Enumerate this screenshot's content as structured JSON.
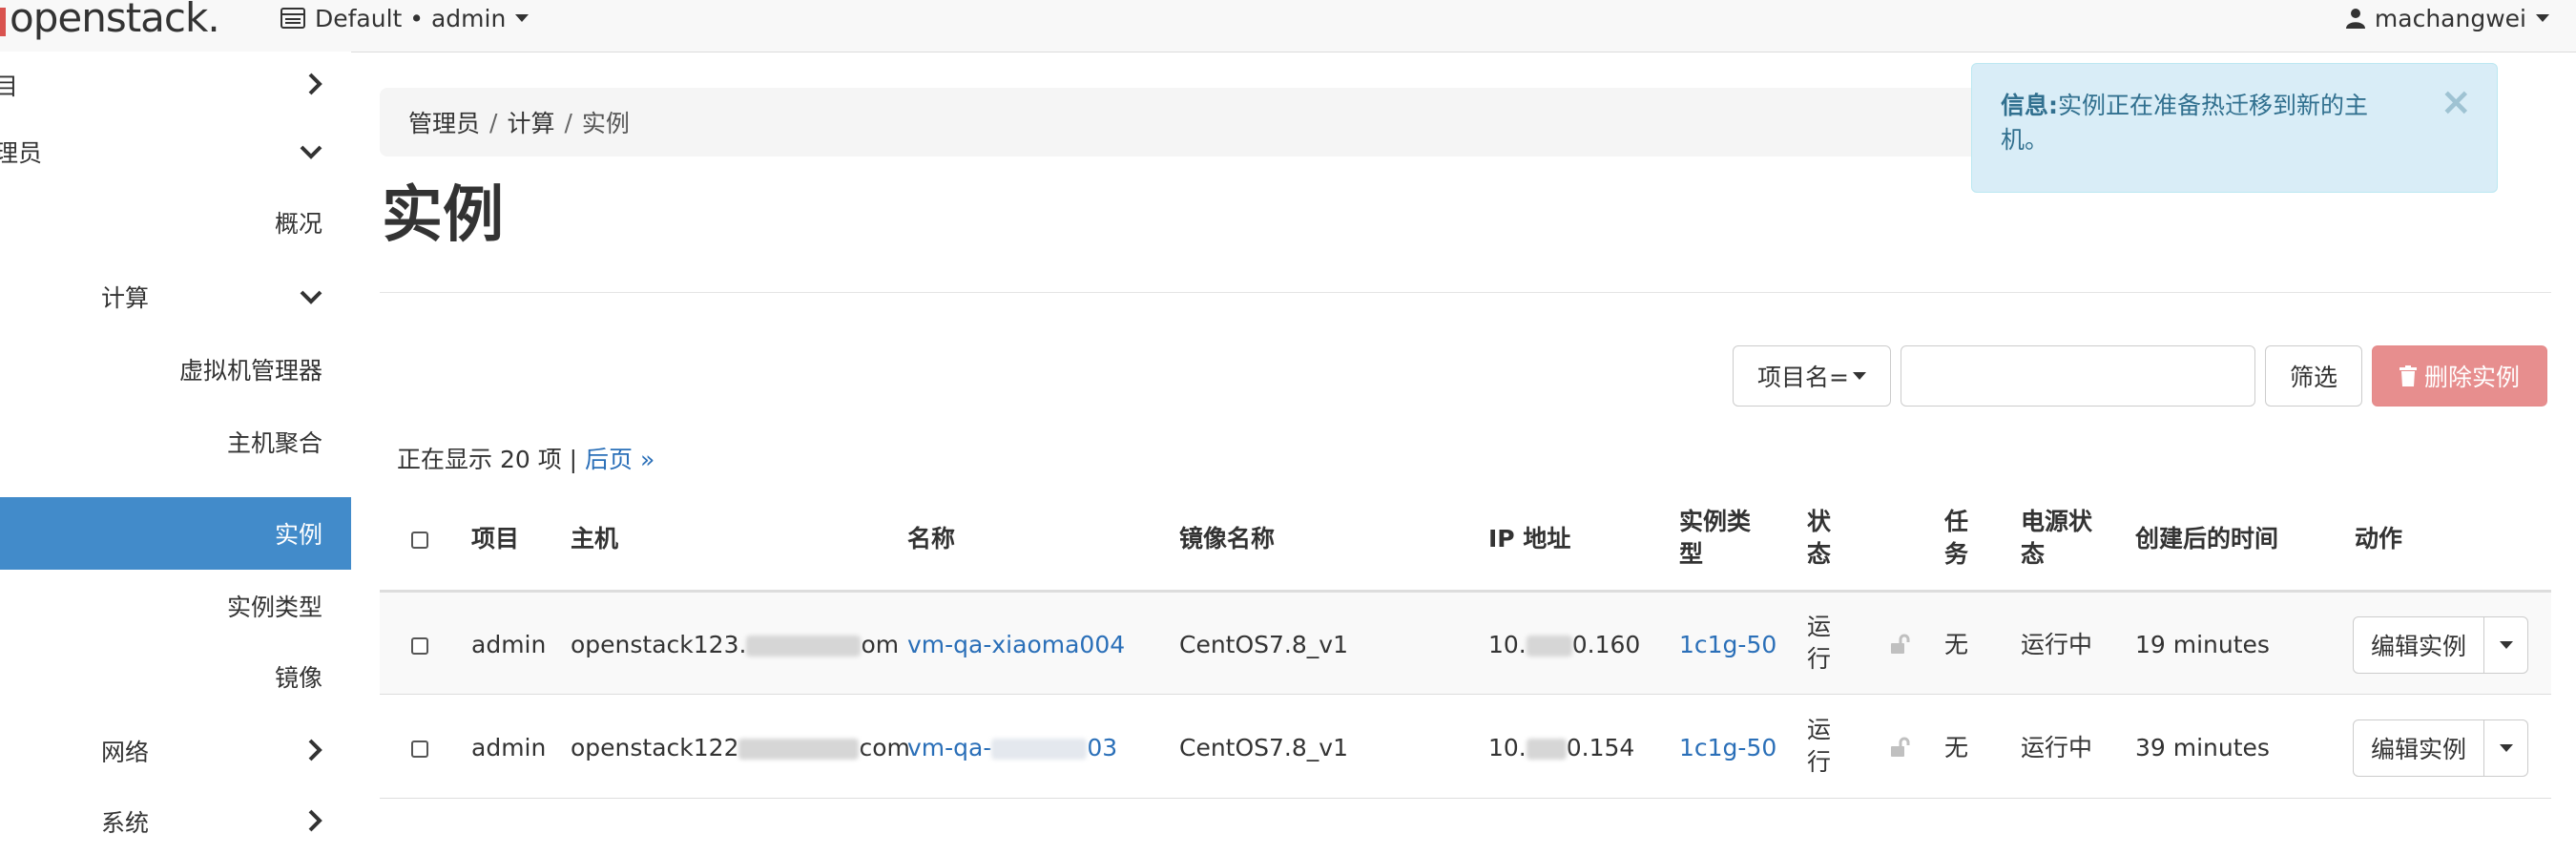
{
  "navbar": {
    "brand": "openstack.",
    "context": "Default • admin",
    "user": "machangwei"
  },
  "sidebar": {
    "items": [
      {
        "label": "目"
      },
      {
        "label": "理员"
      },
      {
        "label": "概况"
      },
      {
        "label": "计算"
      },
      {
        "label": "虚拟机管理器"
      },
      {
        "label": "主机聚合"
      },
      {
        "label": "实例"
      },
      {
        "label": "实例类型"
      },
      {
        "label": "镜像"
      },
      {
        "label": "网络"
      },
      {
        "label": "系统"
      }
    ]
  },
  "breadcrumb": [
    "管理员",
    "计算",
    "实例"
  ],
  "page_title": "实例",
  "alert": {
    "prefix": "信息:",
    "message": "实例正在准备热迁移到新的主机。",
    "close": "×"
  },
  "filter": {
    "field": "项目名=",
    "input_value": "",
    "filter_label": "筛选",
    "delete_label": "删除实例"
  },
  "count": {
    "text": "正在显示 20 项 |",
    "next": "后页 »"
  },
  "table": {
    "headers": {
      "project": "项目",
      "host": "主机",
      "name": "名称",
      "image": "镜像名称",
      "ip": "IP 地址",
      "flavor1": "实例类",
      "flavor2": "型",
      "status1": "状",
      "status2": "态",
      "task1": "任",
      "task2": "务",
      "power1": "电源状",
      "power2": "态",
      "age": "创建后的时间",
      "actions": "动作"
    },
    "rows": [
      {
        "project": "admin",
        "host_a": "openstack123.",
        "host_b": "om",
        "name_a": "vm-qa-xiaoma004",
        "name_b": "",
        "image": "CentOS7.8_v1",
        "ip_a": "10.",
        "ip_b": "0.160",
        "flavor": "1c1g-50",
        "status1": "运",
        "status2": "行",
        "task": "无",
        "power": "运行中",
        "age": "19 minutes",
        "action": "编辑实例"
      },
      {
        "project": "admin",
        "host_a": "openstack122",
        "host_b": "com",
        "name_a": "vm-qa-",
        "name_b": "03",
        "image": "CentOS7.8_v1",
        "ip_a": "10.",
        "ip_b": "0.154",
        "flavor": "1c1g-50",
        "status1": "运",
        "status2": "行",
        "task": "无",
        "power": "运行中",
        "age": "39 minutes",
        "action": "编辑实例"
      }
    ]
  }
}
